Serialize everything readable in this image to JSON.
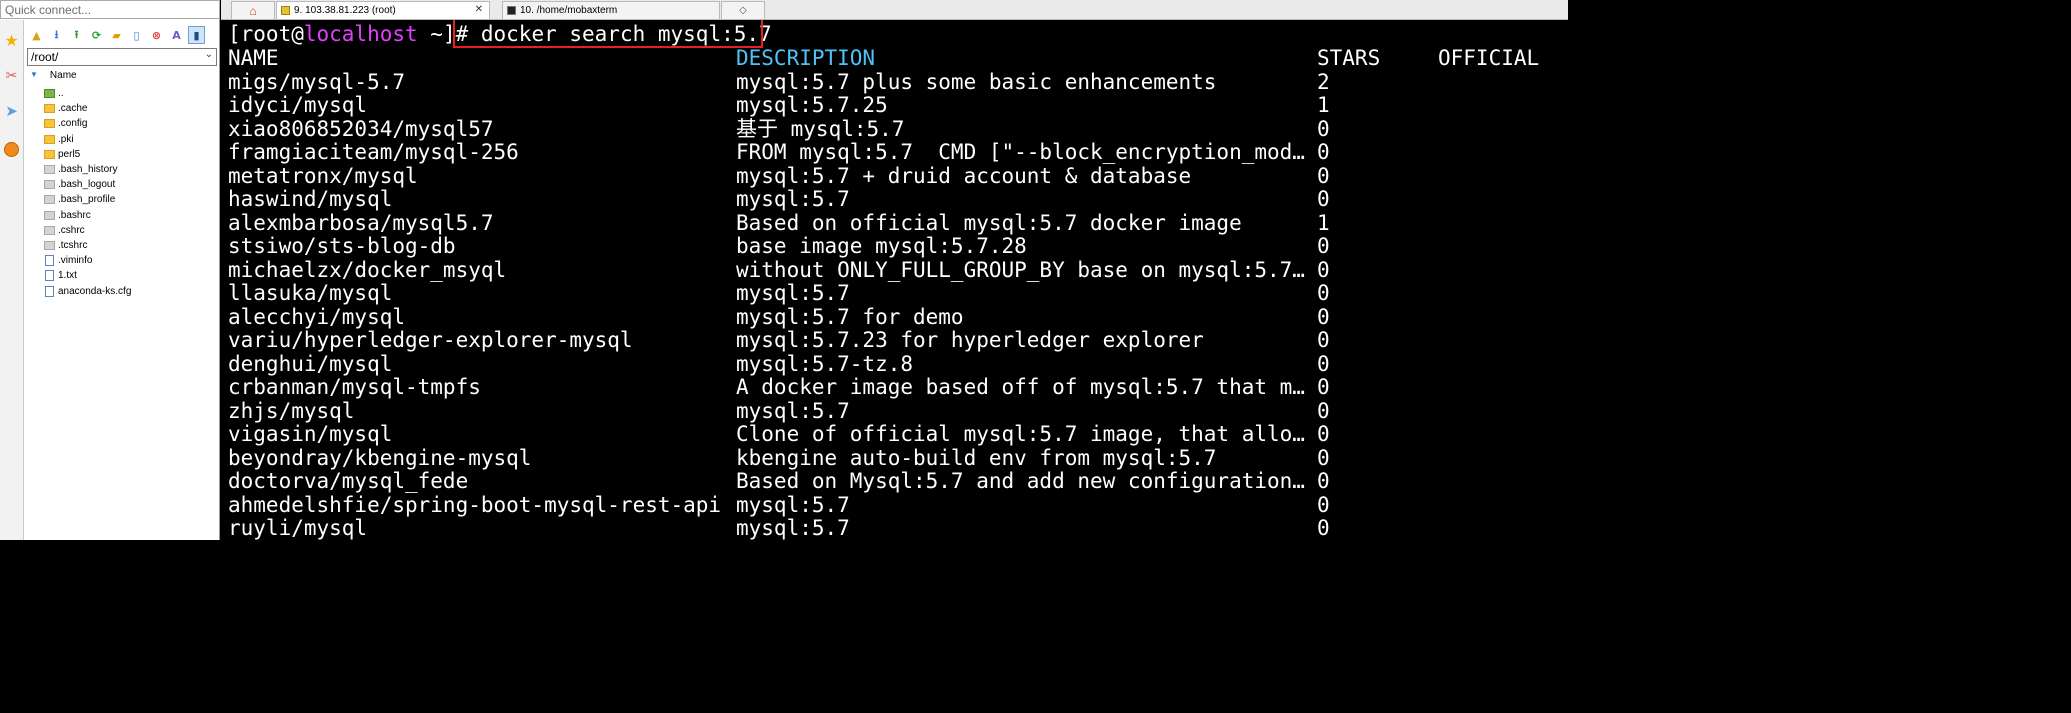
{
  "app": {
    "quick_connect_placeholder": "Quick connect...",
    "accent_color": "#e040fb",
    "highlight_color": "#e8201b"
  },
  "sidebar": {
    "tabs": [
      {
        "icon": "star-icon"
      },
      {
        "icon": "tools-icon"
      },
      {
        "icon": "send-icon"
      },
      {
        "icon": "macros-icon"
      }
    ],
    "toolbar": [
      {
        "icon": "up-folder-icon"
      },
      {
        "icon": "download-icon"
      },
      {
        "icon": "upload-icon"
      },
      {
        "icon": "refresh-icon"
      },
      {
        "icon": "new-folder-icon"
      },
      {
        "icon": "new-file-icon"
      },
      {
        "icon": "delete-icon"
      },
      {
        "icon": "rename-icon"
      },
      {
        "icon": "terminal-follow-icon"
      }
    ],
    "path": "/root/",
    "column_header": "Name",
    "files": [
      {
        "name": "..",
        "type": "up"
      },
      {
        "name": ".cache",
        "type": "folder"
      },
      {
        "name": ".config",
        "type": "folder"
      },
      {
        "name": ".pki",
        "type": "folder"
      },
      {
        "name": "perl5",
        "type": "folder"
      },
      {
        "name": ".bash_history",
        "type": "dotfile"
      },
      {
        "name": ".bash_logout",
        "type": "dotfile"
      },
      {
        "name": ".bash_profile",
        "type": "dotfile"
      },
      {
        "name": ".bashrc",
        "type": "dotfile"
      },
      {
        "name": ".cshrc",
        "type": "dotfile"
      },
      {
        "name": ".tcshrc",
        "type": "dotfile"
      },
      {
        "name": ".viminfo",
        "type": "txtfile"
      },
      {
        "name": "1.txt",
        "type": "txtfile"
      },
      {
        "name": "anaconda-ks.cfg",
        "type": "txtfile"
      }
    ]
  },
  "tabs": [
    {
      "label": "",
      "icon": "home-icon"
    },
    {
      "label": "9. 103.38.81.223 (root)",
      "icon": "ssh-icon",
      "active": true
    },
    {
      "label": "10. /home/mobaxterm",
      "icon": "terminal-icon"
    },
    {
      "label": "",
      "icon": "new-tab-icon"
    }
  ],
  "terminal": {
    "prompt_open": "[root@",
    "prompt_host": "localhost",
    "prompt_close": " ~]# ",
    "command": "docker search mysql:5.7",
    "headers": {
      "name": "NAME",
      "description": "DESCRIPTION",
      "stars": "STARS",
      "official": "OFFICIAL"
    },
    "rows": [
      {
        "name": "migs/mysql-5.7",
        "description": "mysql:5.7 plus some basic enhancements",
        "stars": "2"
      },
      {
        "name": "idyci/mysql",
        "description": "mysql:5.7.25",
        "stars": "1"
      },
      {
        "name": "xiao806852034/mysql57",
        "description": "基于 mysql:5.7",
        "stars": "0"
      },
      {
        "name": "framgiaciteam/mysql-256",
        "description": "FROM mysql:5.7  CMD [\"--block_encryption_mod…",
        "stars": "0"
      },
      {
        "name": "metatronx/mysql",
        "description": "mysql:5.7 + druid account & database",
        "stars": "0"
      },
      {
        "name": "haswind/mysql",
        "description": "mysql:5.7",
        "stars": "0"
      },
      {
        "name": "alexmbarbosa/mysql5.7",
        "description": "Based on official mysql:5.7 docker image",
        "stars": "1"
      },
      {
        "name": "stsiwo/sts-blog-db",
        "description": "base image mysql:5.7.28",
        "stars": "0"
      },
      {
        "name": "michaelzx/docker_msyql",
        "description": "without ONLY_FULL_GROUP_BY base on mysql:5.7…",
        "stars": "0"
      },
      {
        "name": "llasuka/mysql",
        "description": "mysql:5.7",
        "stars": "0"
      },
      {
        "name": "alecchyi/mysql",
        "description": "mysql:5.7 for demo",
        "stars": "0"
      },
      {
        "name": "variu/hyperledger-explorer-mysql",
        "description": "mysql:5.7.23 for hyperledger explorer",
        "stars": "0"
      },
      {
        "name": "denghui/mysql",
        "description": "mysql:5.7-tz.8",
        "stars": "0"
      },
      {
        "name": "crbanman/mysql-tmpfs",
        "description": "A docker image based off of mysql:5.7 that m…",
        "stars": "0"
      },
      {
        "name": "zhjs/mysql",
        "description": "mysql:5.7",
        "stars": "0"
      },
      {
        "name": "vigasin/mysql",
        "description": "Clone of official mysql:5.7 image, that allo…",
        "stars": "0"
      },
      {
        "name": "beyondray/kbengine-mysql",
        "description": "kbengine auto-build env from mysql:5.7",
        "stars": "0"
      },
      {
        "name": "doctorva/mysql_fede",
        "description": "Based on Mysql:5.7 and add new configuration…",
        "stars": "0"
      },
      {
        "name": "ahmedelshfie/spring-boot-mysql-rest-api",
        "description": "mysql:5.7",
        "stars": "0"
      },
      {
        "name": "ruyli/mysql",
        "description": "mysql:5.7",
        "stars": "0"
      }
    ]
  }
}
